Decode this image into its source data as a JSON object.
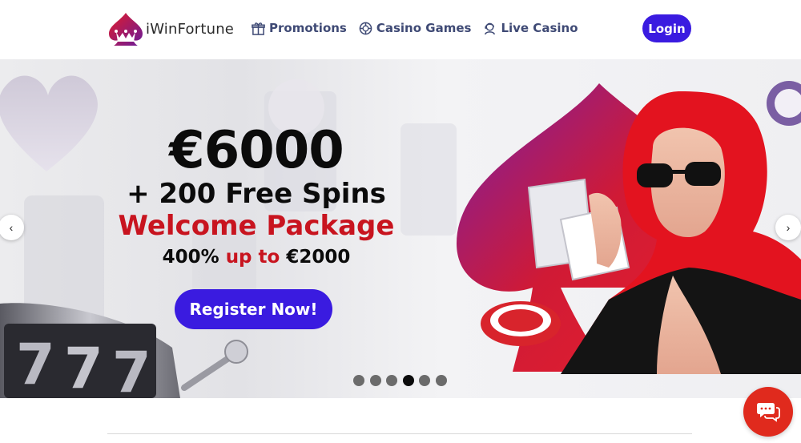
{
  "header": {
    "logo_text": "iWinFortune",
    "logo_icon": "spade-crown-logo",
    "nav": [
      {
        "label": "Promotions",
        "icon": "gift-icon"
      },
      {
        "label": "Casino Games",
        "icon": "casino-chip-icon"
      },
      {
        "label": "Live Casino",
        "icon": "dealer-icon"
      }
    ],
    "login_label": "Login"
  },
  "banner": {
    "amount": "€6000",
    "spins": "+ 200 Free Spins",
    "welcome": "Welcome Package",
    "bonus_percent": "400%",
    "bonus_up_to": "up to",
    "bonus_amount": "€2000",
    "register_label": "Register Now!",
    "prev_arrow": "‹",
    "next_arrow": "›",
    "slide_count": 6,
    "active_slide": 4
  },
  "colors": {
    "accent": "#3a1be0",
    "red": "#c8141f",
    "chat": "#e02a1d",
    "nav_text": "#3f4a75"
  },
  "chat": {
    "icon": "chat-bubbles-icon"
  }
}
